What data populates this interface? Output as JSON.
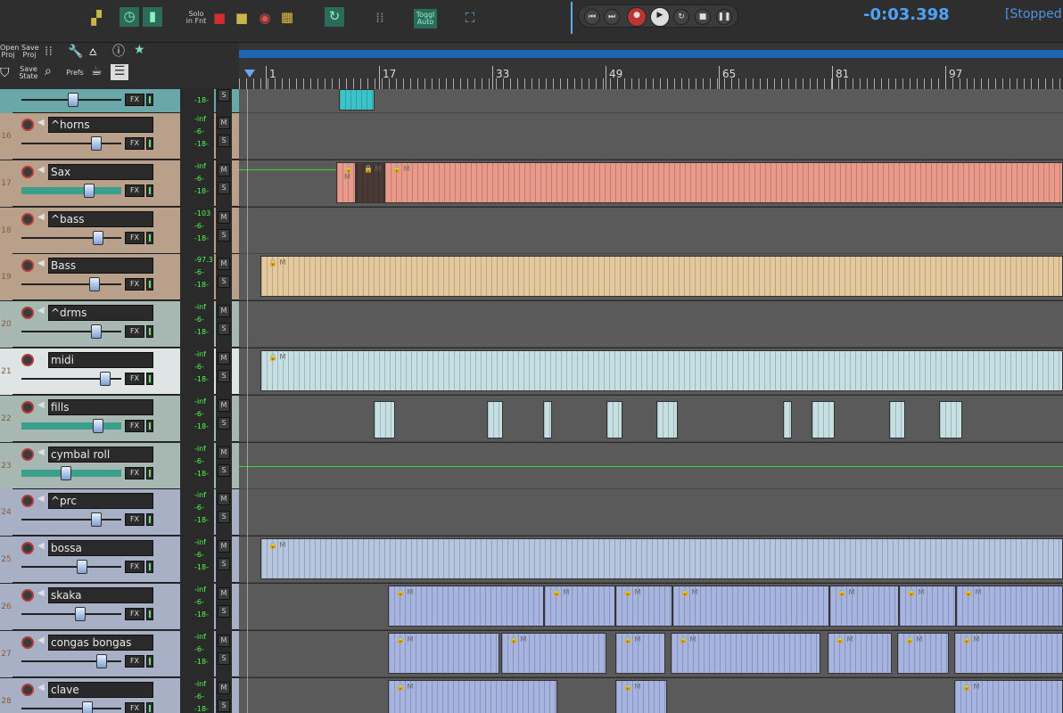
{
  "toolbar": {
    "solo_label": "Solo\nin Fnt",
    "toggle_auto_label": "Toggl\nAuto"
  },
  "transport": {
    "time": "-0:03.398",
    "status": "[Stopped]"
  },
  "left_tools": {
    "open_proj": "Open\nProj",
    "save_proj": "Save\nProj",
    "save_state": "Save\nState",
    "prefs": "Prefs"
  },
  "ruler": {
    "labels": [
      "1",
      "17",
      "33",
      "49",
      "65",
      "81",
      "97"
    ]
  },
  "tracks": [
    {
      "num": "",
      "name": "",
      "meter": [
        "-18-"
      ],
      "color": "#6aa7a8"
    },
    {
      "num": "16",
      "name": "^horns",
      "meter": [
        "-inf",
        "-6-",
        "-18-"
      ],
      "color": "#b8a08a"
    },
    {
      "num": "17",
      "name": "Sax",
      "meter": [
        "-inf",
        "-6-",
        "-18-"
      ],
      "color": "#b8a08a"
    },
    {
      "num": "18",
      "name": "^bass",
      "meter": [
        "-103",
        "-6-",
        "-18-"
      ],
      "color": "#b8a08a"
    },
    {
      "num": "19",
      "name": "Bass",
      "meter": [
        "-97.3",
        "-6-",
        "-18-"
      ],
      "color": "#b8a08a"
    },
    {
      "num": "20",
      "name": "^drms",
      "meter": [
        "-inf",
        "-6-",
        "-18-"
      ],
      "color": "#a7b8b3"
    },
    {
      "num": "21",
      "name": "midi",
      "meter": [
        "-inf",
        "-6-",
        "-18-"
      ],
      "color": "#dfe5e4"
    },
    {
      "num": "22",
      "name": "fills",
      "meter": [
        "-inf",
        "-6-",
        "-18-"
      ],
      "color": "#a7b8b3"
    },
    {
      "num": "23",
      "name": "cymbal roll",
      "meter": [
        "-inf",
        "-6-",
        "-18-"
      ],
      "color": "#a7b8b3"
    },
    {
      "num": "24",
      "name": "^prc",
      "meter": [
        "-inf",
        "-6-",
        "-18-"
      ],
      "color": "#a7b0c4"
    },
    {
      "num": "25",
      "name": "bossa",
      "meter": [
        "-inf",
        "-6-",
        "-18-"
      ],
      "color": "#a7b0c4"
    },
    {
      "num": "26",
      "name": "skaka",
      "meter": [
        "-inf",
        "-6-",
        "-18-"
      ],
      "color": "#a7b0c4"
    },
    {
      "num": "27",
      "name": "congas bongas",
      "meter": [
        "-inf",
        "-6-",
        "-18-"
      ],
      "color": "#a7b0c4"
    },
    {
      "num": "28",
      "name": "clave",
      "meter": [
        "-inf",
        "-6-",
        "-18-"
      ],
      "color": "#a7b0c4"
    }
  ],
  "labels": {
    "fx": "FX",
    "mute": "M",
    "solo": "S",
    "item_tag": "M"
  }
}
